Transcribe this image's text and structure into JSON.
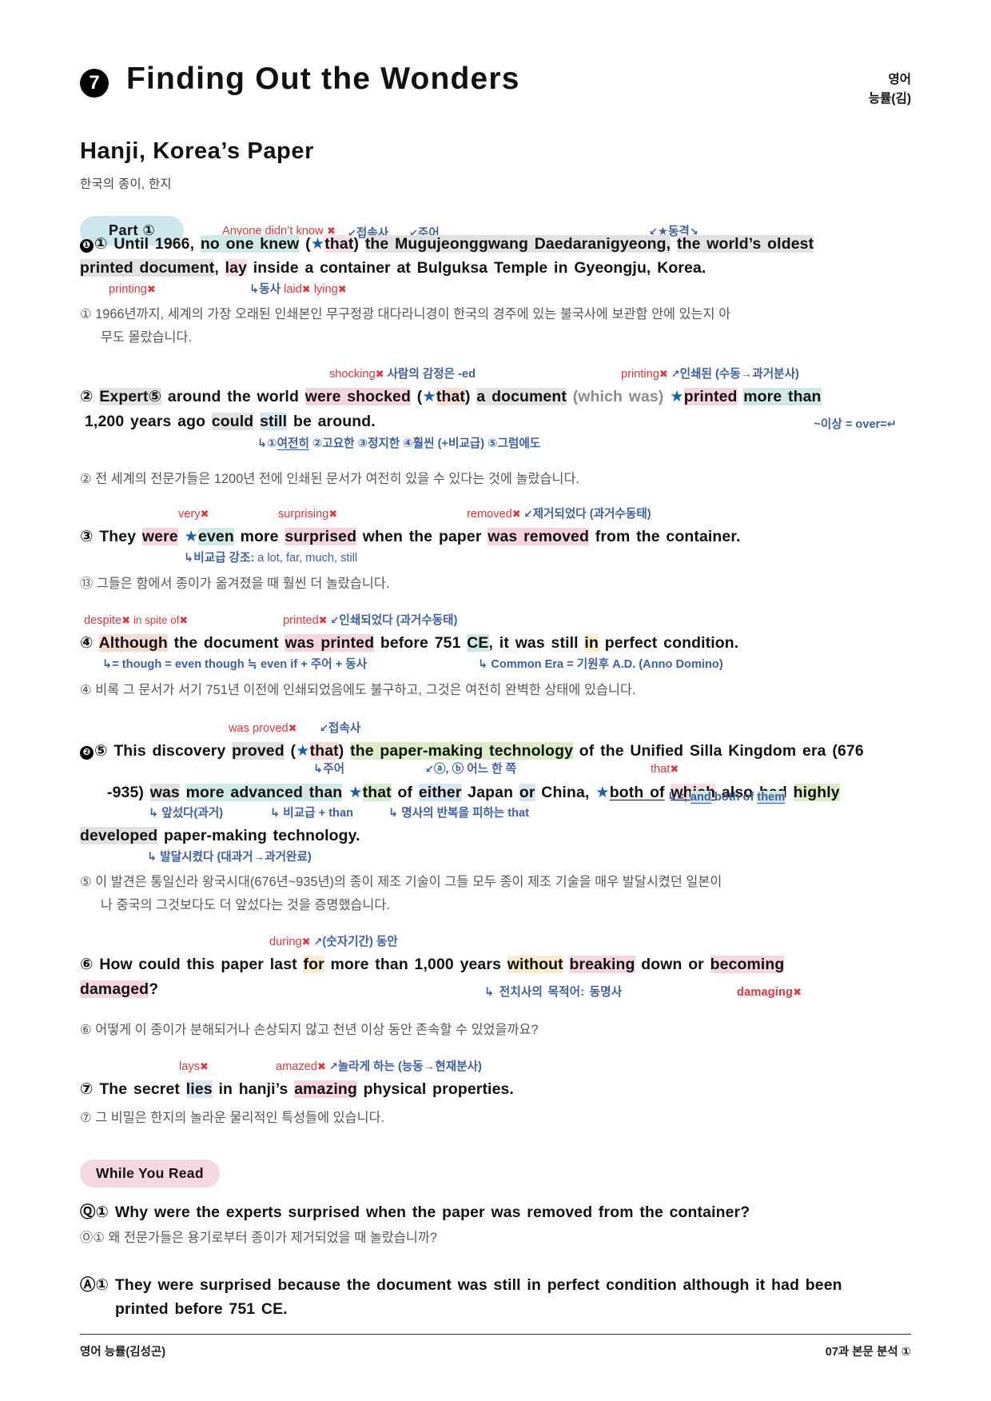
{
  "header": {
    "unit_number": "7",
    "unit_title": "Finding Out the Wonders",
    "subject_line1": "영어",
    "subject_line2": "능률(김)"
  },
  "lesson": {
    "title": "Hanji, Korea’s Paper",
    "subtitle": "한국의 종이, 한지"
  },
  "part_chip": "Part ①",
  "while_you_read_chip": "While You Read",
  "sentences": [
    {
      "id": "s1",
      "marker_circle": "❶",
      "number": "①",
      "en_line1": "Until 1966, no one knew (★that) the Mugujeonggwang Daedaranigyeong, the world’s oldest",
      "en_line2": "printed document, lay inside a container at Bulguksa Temple in Gyeongju, Korea.",
      "ko": "① 1966년까지, 세계의 가장 오래된 인쇄본인 무구정광 대다라니경이 한국의 경주에 있는 불국사에 보관함 안에 있는지 아",
      "ko_line2": "무도 몰랐습니다.",
      "ann_above": [
        {
          "text": "Anyone didn’t know",
          "mark": "✖",
          "color": "red"
        },
        {
          "text": "접속사",
          "hook": "↙",
          "color": "blue"
        },
        {
          "text": "주어",
          "hook": "↙",
          "color": "blue"
        },
        {
          "text": "★동격",
          "hook": "↙",
          "tail": "↘",
          "color": "blue"
        }
      ],
      "ann_below": [
        {
          "text": "printing",
          "mark": "✖",
          "color": "red"
        },
        {
          "text": "동사",
          "hook": "↳",
          "color": "blue"
        },
        {
          "text": "laid",
          "mark": "✖",
          "color": "red"
        },
        {
          "text": "lying",
          "mark": "✖",
          "color": "red"
        }
      ]
    },
    {
      "id": "s2",
      "number": "②",
      "en_line1": "Expert⑤ around the world were shocked (★that) a document (which was) ★printed more than",
      "en_line2": "1,200 years ago could still be around.",
      "ko": "② 전 세계의 전문가들은 1200년 전에 인쇄된 문서가 여전히 있을 수 있다는 것에 놀랐습니다.",
      "ann_above": [
        {
          "text": "shocking",
          "mark": "✖",
          "color": "red"
        },
        {
          "text": "사람의 감정은 -ed",
          "color": "blue"
        },
        {
          "text": "printing",
          "mark": "✖",
          "color": "red"
        },
        {
          "text": "인쇄된 (수동→과거분사)",
          "hook": "↗",
          "color": "blue"
        }
      ],
      "ann_below": [
        {
          "text": "~이상 = over=↵",
          "color": "blue"
        },
        {
          "text": "↳①여전히 ②고요한 ③정지한 ④훨씬 (+비교급) ⑤그럼에도",
          "color": "blue"
        }
      ]
    },
    {
      "id": "s3",
      "number": "③",
      "en_line1": "They were ★even more surprised when the paper was removed from the container.",
      "ko": "⑬ 그들은 함에서 종이가 옮겨졌을 때 훨씬 더 놀랐습니다.",
      "ann_above": [
        {
          "text": "very",
          "mark": "✖",
          "color": "red"
        },
        {
          "text": "surprising",
          "mark": "✖",
          "color": "red"
        },
        {
          "text": "removed",
          "mark": "✖",
          "color": "red"
        },
        {
          "text": "제거되었다 (과거수동태)",
          "hook": "↙",
          "color": "blue"
        }
      ],
      "ann_below": [
        {
          "text": "↳비교급 강조:",
          "color": "blue",
          "extra": "a lot, far, much, still"
        }
      ]
    },
    {
      "id": "s4",
      "number": "④",
      "en_line1": "Although the document was printed before 751 CE, it was still in perfect condition.",
      "ko": "④ 비록 그 문서가 서기 751년 이전에 인쇄되었음에도 불구하고, 그것은 여전히 완벽한 상태에 있습니다.",
      "ann_above": [
        {
          "text": "despite",
          "mark": "✖",
          "color": "red"
        },
        {
          "text": "in spite of",
          "mark": "✖",
          "color": "red"
        },
        {
          "text": "printed",
          "mark": "✖",
          "color": "red"
        },
        {
          "text": "인쇄되었다 (과거수동태)",
          "hook": "↙",
          "color": "blue"
        }
      ],
      "ann_below": [
        {
          "text": "↳= though = even though ≒ even if + 주어 + 동사",
          "color": "blue"
        },
        {
          "text": "↳ Common Era = 기원후 A.D. (Anno Domino)",
          "color": "blue"
        }
      ]
    },
    {
      "id": "s5",
      "marker_circle": "❷",
      "number": "⑤",
      "en_line1": "This discovery proved (★that) the paper-making technology of the Unified Silla Kingdom era (676",
      "en_line2": "-935) was more advanced than ★that of either Japan or China, ★both of which also had highly",
      "en_line3": "developed paper-making technology.",
      "ko": "⑤ 이 발견은 통일신라 왕국시대(676년~935년)의 종이 제조 기술이 그들 모두 종이 제조 기술을 매우 발달시켰던 일본이",
      "ko_line2": "나 중국의 그것보다도 더 앞섰다는 것을 증명했습니다.",
      "ann_above": [
        {
          "text": "was proved",
          "mark": "✖",
          "color": "red"
        },
        {
          "text": "접속사",
          "hook": "↙",
          "color": "blue"
        }
      ],
      "ann_mid": [
        {
          "text": "↳주어",
          "color": "blue"
        },
        {
          "text": "ⓐ, ⓑ 어느 한 쪽",
          "hook": "↙",
          "color": "blue"
        },
        {
          "text": "that",
          "mark": "✖",
          "color": "red"
        }
      ],
      "ann_below": [
        {
          "text": "↳ 앞섰다(과거)",
          "color": "blue"
        },
        {
          "text": "↳ 비교급 + than",
          "color": "blue"
        },
        {
          "text": "↳ 명사의 반복을 피하는 that",
          "color": "blue"
        },
        {
          "text": "↳=, and both of them",
          "color": "blue"
        },
        {
          "text": "↳ 발달시켰다 (대과거→과거완료)",
          "color": "blue"
        }
      ]
    },
    {
      "id": "s6",
      "number": "⑥",
      "en_line1": "How could this paper last for more than 1,000 years without breaking down or becoming",
      "en_line2": "damaged?",
      "ko": "⑥ 어떻게 이 종이가 분해되거나 손상되지 않고 천년 이상 동안 존속할 수 있었을까요?",
      "ann_above": [
        {
          "text": "during",
          "mark": "✖",
          "color": "red"
        },
        {
          "text": "(숫자기간) 동안",
          "hook": "↗",
          "color": "blue"
        }
      ],
      "ann_below": [
        {
          "text": "↳ 전치사의 목적어: 동명사",
          "color": "blue"
        },
        {
          "text": "damaging",
          "mark": "✖",
          "color": "red"
        }
      ]
    },
    {
      "id": "s7",
      "number": "⑦",
      "en_line1": "The secret lies in hanji’s amazing physical properties.",
      "ko": "⑦ 그 비밀은 한지의 놀라운 물리적인 특성들에 있습니다.",
      "ann_above": [
        {
          "text": "lays",
          "mark": "✖",
          "color": "red"
        },
        {
          "text": "amazed",
          "mark": "✖",
          "color": "red"
        },
        {
          "text": "놀라게 하는 (능동→현재분사)",
          "hook": "↗",
          "color": "blue"
        }
      ]
    }
  ],
  "while_you_read": {
    "question_label": "Ⓠ①",
    "question_en": "Why were the experts surprised when the paper was removed from the container?",
    "question_ko": "Ⓞ① 왜 전문가들은 용기로부터 종이가 제거되었을 때 놀랐습니까?",
    "answer_label": "Ⓐ①",
    "answer_en_line1": "They were surprised because the document was still in perfect condition although it had been",
    "answer_en_line2": "printed before 751 CE."
  },
  "footer": {
    "left": "영어 능률(김성곤)",
    "right": "07과 본문 분석 ①"
  },
  "colors": {
    "chip_part": "#cde8ec",
    "chip_wyr": "#f6d7e4",
    "red": "#e0383e",
    "blue": "#3b5fa8"
  }
}
